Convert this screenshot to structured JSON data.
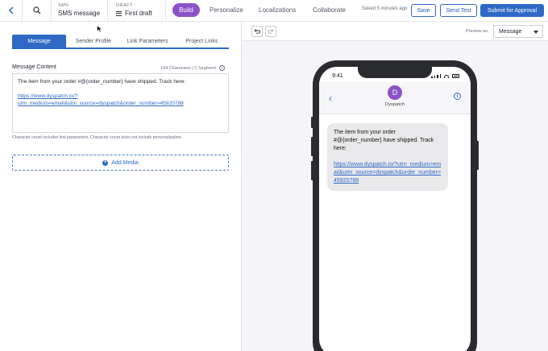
{
  "topbar": {
    "channel_label": "SMS",
    "channel_name": "SMS message",
    "draft_label": "DRAFT",
    "draft_name": "First draft",
    "nav": [
      "Build",
      "Personalize",
      "Localizations",
      "Collaborate"
    ],
    "saved_status": "Saved 5 minutes ago",
    "save_label": "Save",
    "send_test_label": "Send Test",
    "submit_label": "Submit for Approval"
  },
  "tabs": [
    "Message",
    "Sender Profile",
    "Link Parameters",
    "Project Links"
  ],
  "editor": {
    "label": "Message Content",
    "count": "154 Characters | 1 Segment",
    "help_glyph": "?",
    "line1": "The item from your order #@{order_number} have shipped. Track here:",
    "link_line1": "https://www.dyspatch.io/?",
    "link_line2": "utm_medium=email&utm_source=dyspatch&order_number=45920788",
    "hint": "Character count includes link parameters. Character count does not include personalization.",
    "add_media": "Add Media"
  },
  "preview": {
    "label": "Preview as:",
    "selected": "Message",
    "time": "9:41",
    "avatar_letter": "D",
    "sender": "Dyspatch",
    "message_text": "The item from your order #@{order_number} have shipped. Track here:",
    "message_link": "https://www.dyspatch.io/?utm_medium=email&utm_source=dyspatch&order_number=45920788"
  },
  "colors": {
    "accent": "#2e69c6",
    "build_pill": "#8b52c9"
  }
}
